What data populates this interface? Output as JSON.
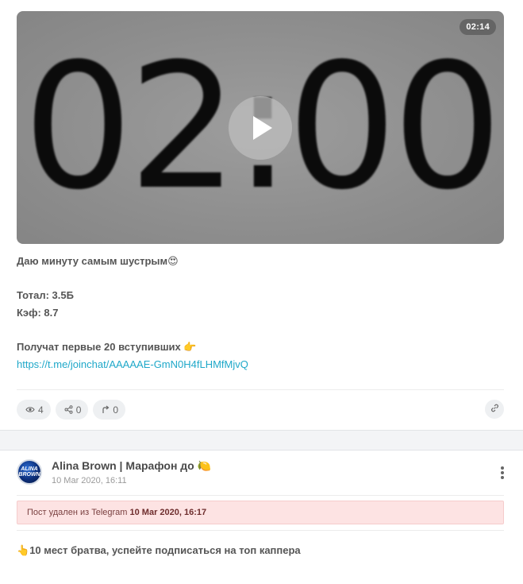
{
  "post1": {
    "video": {
      "frame_text": "02:00",
      "duration": "02:14"
    },
    "text_line1": "Даю минуту самым шустрым",
    "emoji_heart_eyes": "😍",
    "text_total": "Тотал: 3.5Б",
    "text_coef": "Кэф: 8.7",
    "text_join": "Получат первые 20 вступивших",
    "emoji_point_right": "👉",
    "link": "https://t.me/joinchat/AAAAAE-GmN0H4fLHMfMjvQ",
    "stats": {
      "views": "4",
      "shares": "0",
      "forwards": "0"
    },
    "icons": {
      "views": "eye-icon",
      "shares": "share-icon",
      "forwards": "forward-arrow-icon",
      "link": "link-icon"
    }
  },
  "post2": {
    "avatar_text": "ALINA BROWN",
    "channel_name": "Alina Brown | Марафон до",
    "channel_emoji": "🍋",
    "date": "10 Мar 2020, 16:11",
    "deleted_notice": "Пост удален из Telegram",
    "deleted_time": "10 Mar 2020, 16:17",
    "emoji_point_up": "👆",
    "text": "10 мест братва, успейте подписаться на топ каппера"
  },
  "colors": {
    "link": "#1fa8c9",
    "deleted_banner_bg": "#fde3e3",
    "pill_bg": "#eef0f2",
    "feed_gap_bg": "#f3f4f6"
  }
}
